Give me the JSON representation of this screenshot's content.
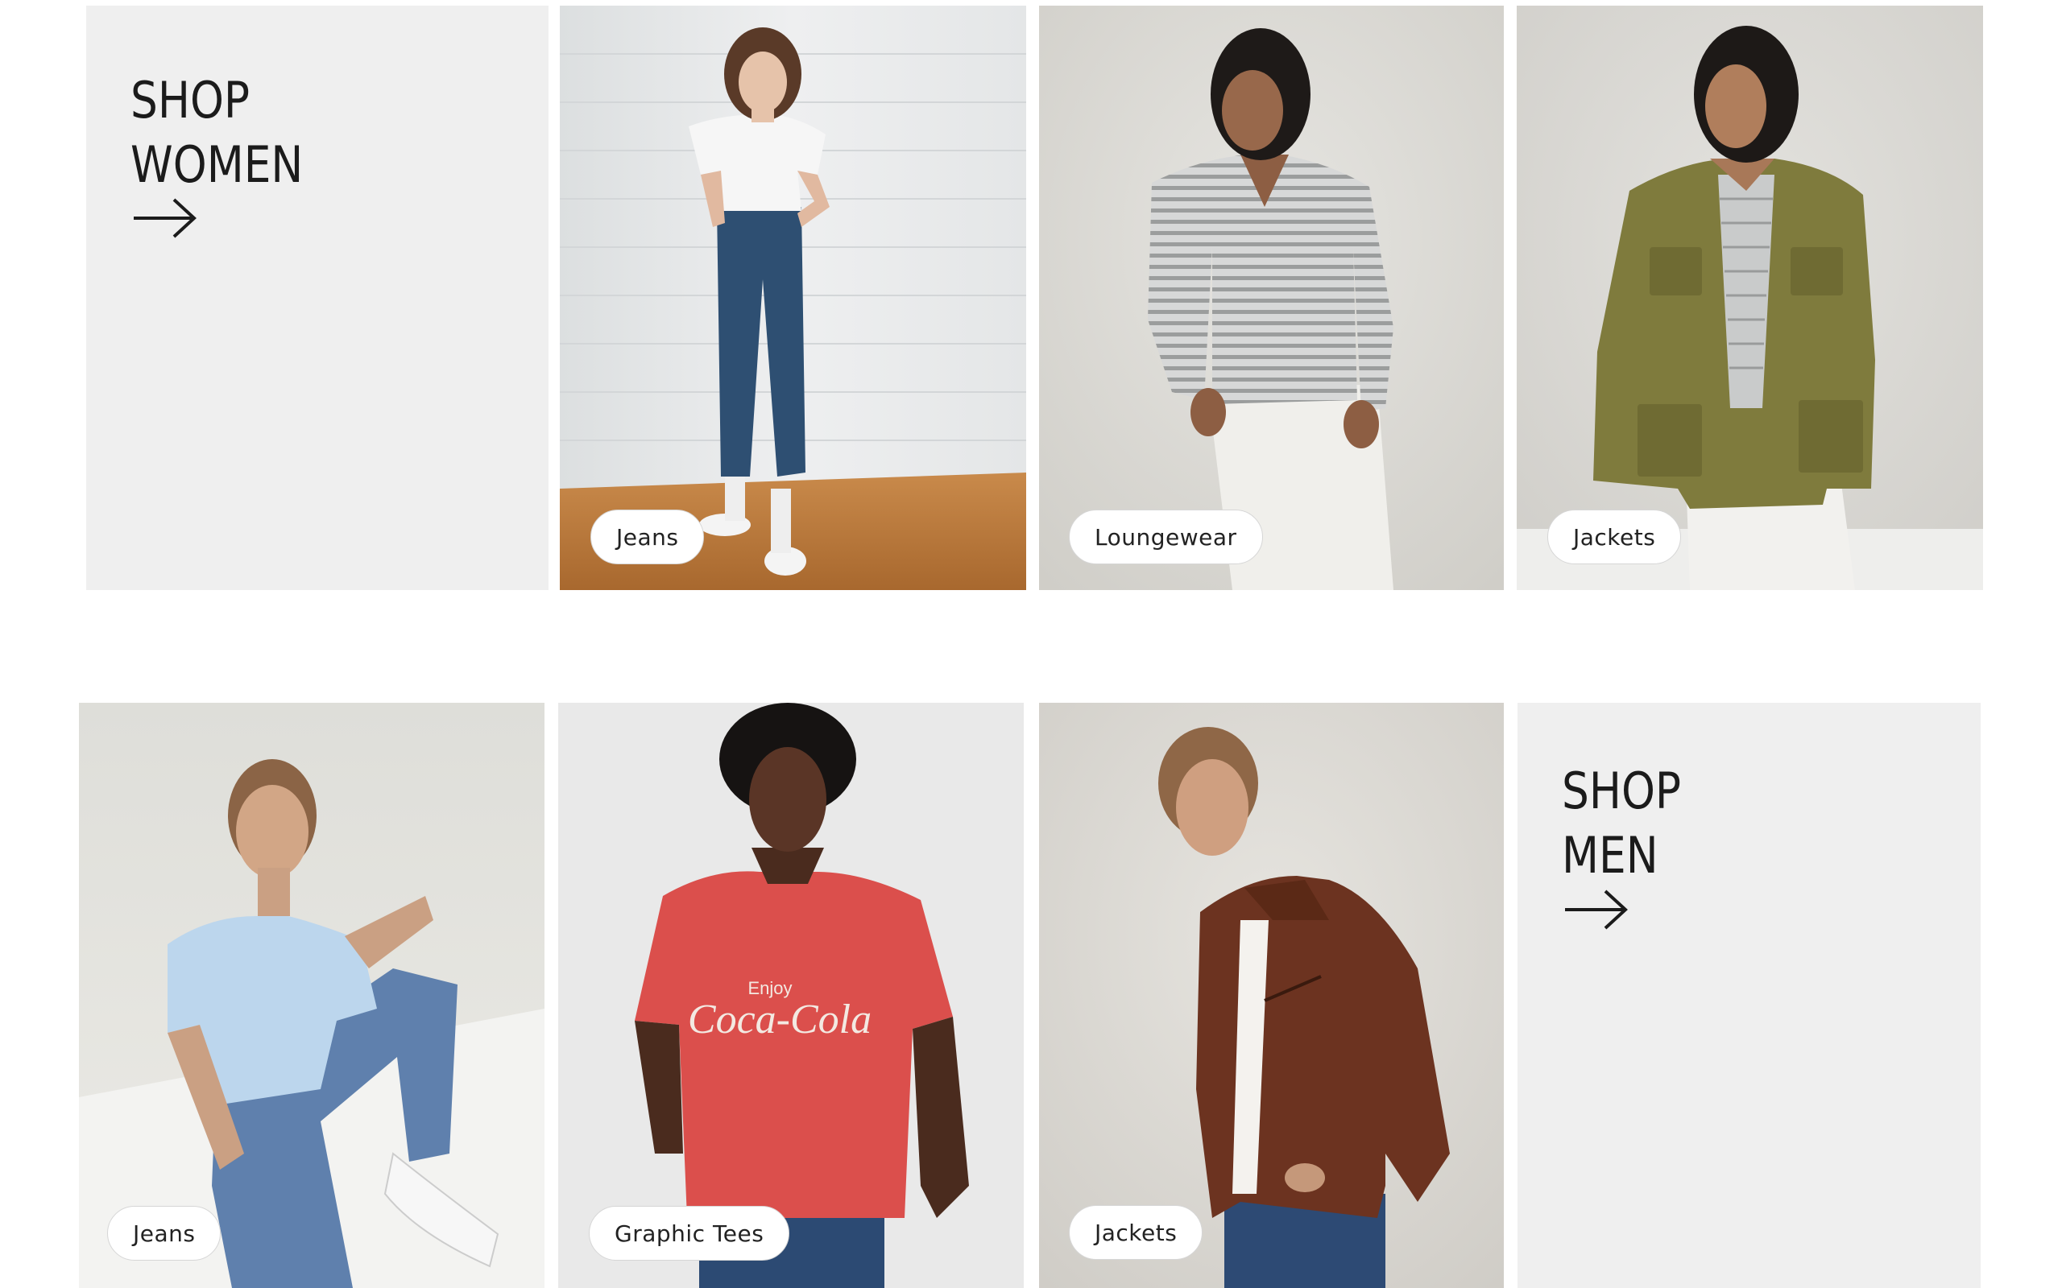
{
  "women": {
    "shop_title_line1": "SHOP",
    "shop_title_line2": "WOMEN",
    "tiles": [
      {
        "label": "Jeans",
        "image": "woman leaning on white brick wall in white tee and blue straight jeans"
      },
      {
        "label": "Loungewear",
        "image": "woman in grey striped v-neck sweater and white pants"
      },
      {
        "label": "Jackets",
        "image": "woman in olive utility jacket over striped top"
      }
    ]
  },
  "men": {
    "shop_title_line1": "SHOP",
    "shop_title_line2": "MEN",
    "tiles": [
      {
        "label": "Jeans",
        "image": "man sitting in light blue tee and blue jeans with white sneakers"
      },
      {
        "label": "Graphic Tees",
        "image": "man in red Coca-Cola graphic tee"
      },
      {
        "label": "Jackets",
        "image": "man in brown leather jacket"
      }
    ]
  },
  "graphic_tee_print": {
    "line1": "Enjoy",
    "line2": "Coca-Cola"
  },
  "colors": {
    "promo_bg": "#efefef",
    "text": "#1b1b1b",
    "pill_bg": "#ffffff",
    "pill_border": "#d6d6d6"
  },
  "icons": {
    "promo_arrow": "arrow-right-icon"
  }
}
